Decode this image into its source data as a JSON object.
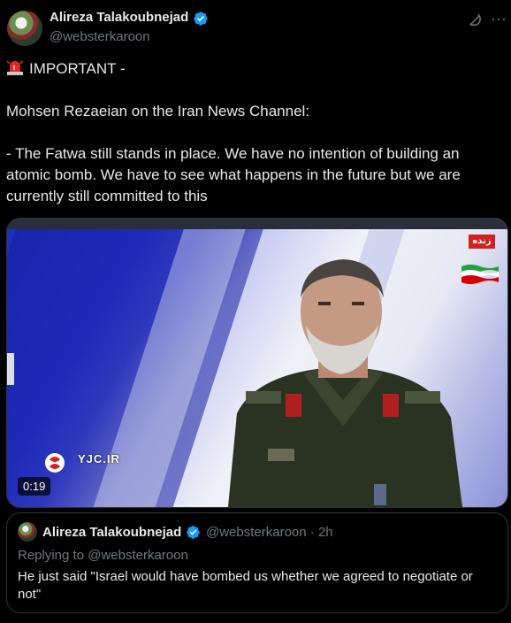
{
  "author": {
    "name": "Alireza Talakoubnejad",
    "handle": "@websterkaroon"
  },
  "tweet": {
    "line1": "IMPORTANT -",
    "line2": "Mohsen Rezaeian on the Iran News Channel:",
    "line3": "- The Fatwa still stands in place. We have no intention of building an atomic bomb. We have to see what happens in the future but we are currently still committed to this"
  },
  "media": {
    "live_badge": "زنده",
    "channel_tag": "YJC.IR",
    "duration": "0:19"
  },
  "quote": {
    "name": "Alireza Talakoubnejad",
    "handle_time": "@websterkaroon · 2h",
    "replying": "Replying to @websterkaroon",
    "text": "He just said \"Israel would have bombed us whether we agreed to negotiate or not\""
  },
  "colors": {
    "background": "#000000",
    "text": "#e7e9ea",
    "muted": "#71767b",
    "verified": "#1d9bf0",
    "border": "#2f3336"
  }
}
